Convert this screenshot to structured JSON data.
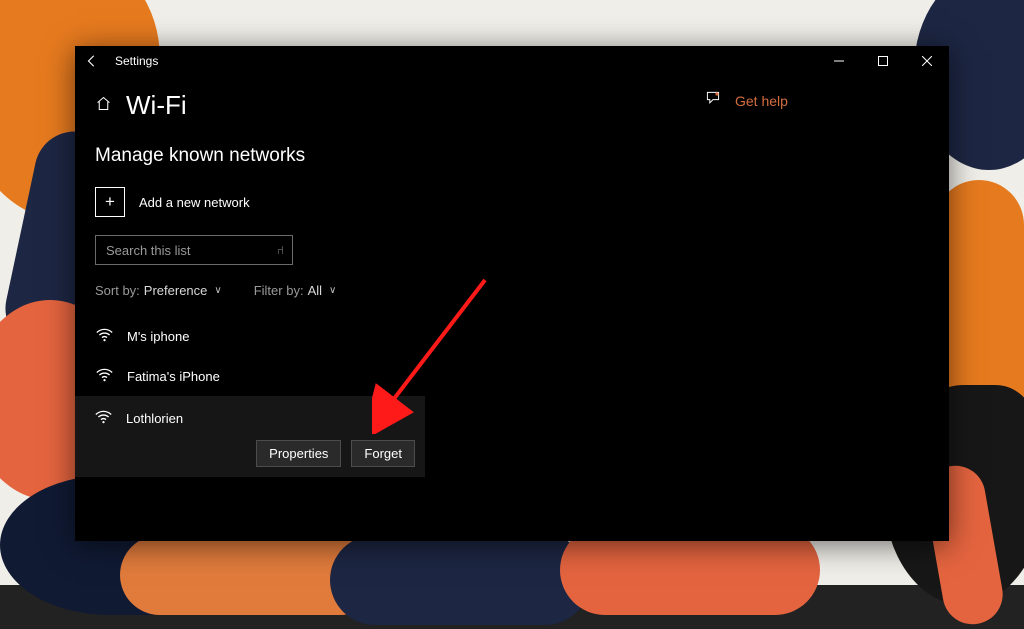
{
  "titlebar": {
    "title": "Settings"
  },
  "header": {
    "page_title": "Wi-Fi"
  },
  "section": {
    "title": "Manage known networks"
  },
  "add_network": {
    "label": "Add a new network"
  },
  "search": {
    "placeholder": "Search this list"
  },
  "filters": {
    "sort_by_label": "Sort by:",
    "sort_by_value": "Preference",
    "filter_by_label": "Filter by:",
    "filter_by_value": "All"
  },
  "networks": [
    {
      "name": "M's iphone"
    },
    {
      "name": "Fatima's iPhone"
    },
    {
      "name": "Lothlorien",
      "selected": true
    }
  ],
  "network_actions": {
    "properties": "Properties",
    "forget": "Forget"
  },
  "help": {
    "label": "Get help"
  }
}
